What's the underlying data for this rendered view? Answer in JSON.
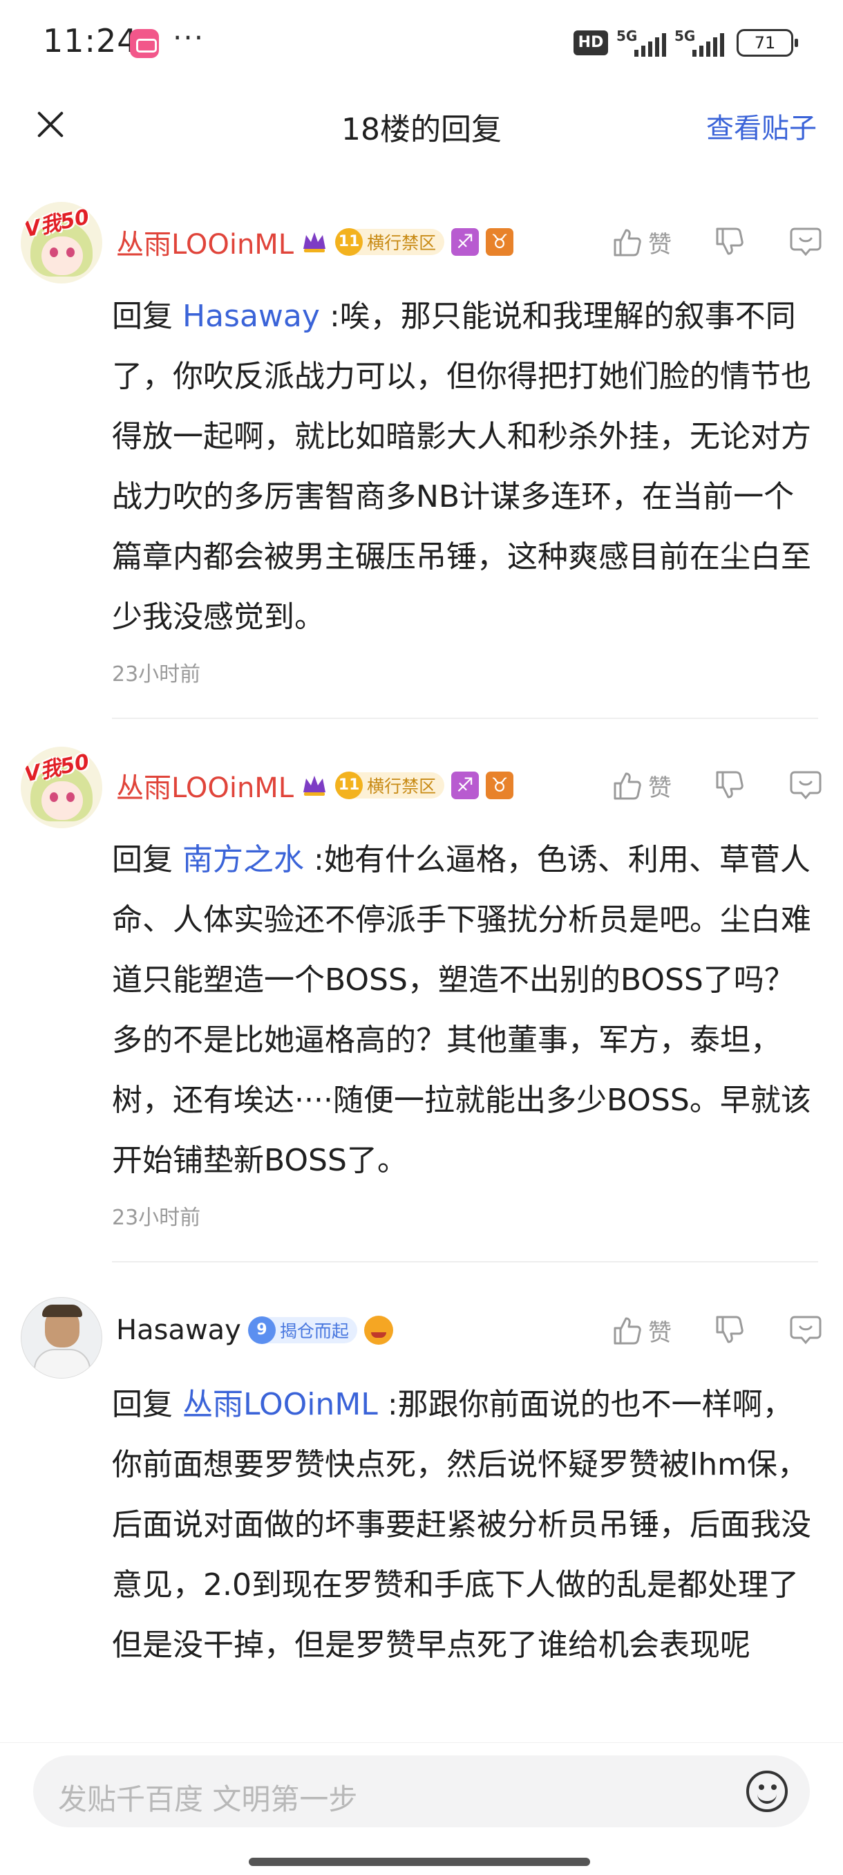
{
  "status": {
    "time": "11:24",
    "dots": "···",
    "hd": "HD",
    "net1": "5G",
    "net2": "5G",
    "battery": "71"
  },
  "header": {
    "title": "18楼的回复",
    "view_post": "查看贴子"
  },
  "replies": [
    {
      "avatar_tag": "V我50",
      "username": "丛雨LOOinML",
      "level": "11",
      "badge_text": "横行禁区",
      "zodiac1": "♐",
      "zodiac2": "♉",
      "like_label": "赞",
      "reply_prefix": "回复",
      "mention": "Hasaway",
      "text": ":唉，那只能说和我理解的叙事不同了，你吹反派战力可以，但你得把打她们脸的情节也得放一起啊，就比如暗影大人和秒杀外挂，无论对方战力吹的多厉害智商多NB计谋多连环，在当前一个篇章内都会被男主碾压吊锤，这种爽感目前在尘白至少我没感觉到。",
      "time": "23小时前"
    },
    {
      "avatar_tag": "V我50",
      "username": "丛雨LOOinML",
      "level": "11",
      "badge_text": "横行禁区",
      "zodiac1": "♐",
      "zodiac2": "♉",
      "like_label": "赞",
      "reply_prefix": "回复",
      "mention": "南方之水",
      "text": ":她有什么逼格，色诱、利用、草菅人命、人体实验还不停派手下骚扰分析员是吧。尘白难道只能塑造一个BOSS，塑造不出别的BOSS了吗？多的不是比她逼格高的？其他董事，军方，泰坦，树，还有埃达····随便一拉就能出多少BOSS。早就该开始铺垫新BOSS了。",
      "time": "23小时前"
    },
    {
      "username": "Hasaway",
      "level": "9",
      "badge_text": "揭仓而起",
      "like_label": "赞",
      "reply_prefix": "回复",
      "mention": "丛雨LOOinML",
      "text": ":那跟你前面说的也不一样啊，你前面想要罗赞快点死，然后说怀疑罗赞被lhm保，后面说对面做的坏事要赶紧被分析员吊锤，后面我没意见，2.0到现在罗赞和手底下人做的乱是都处理了但是没干掉，但是罗赞早点死了谁给机会表现呢"
    }
  ],
  "input": {
    "placeholder": "发贴千百度 文明第一步"
  },
  "colors": {
    "accent": "#3a63d8",
    "username_vip": "#e0443a",
    "muted": "#9a9a9a"
  }
}
